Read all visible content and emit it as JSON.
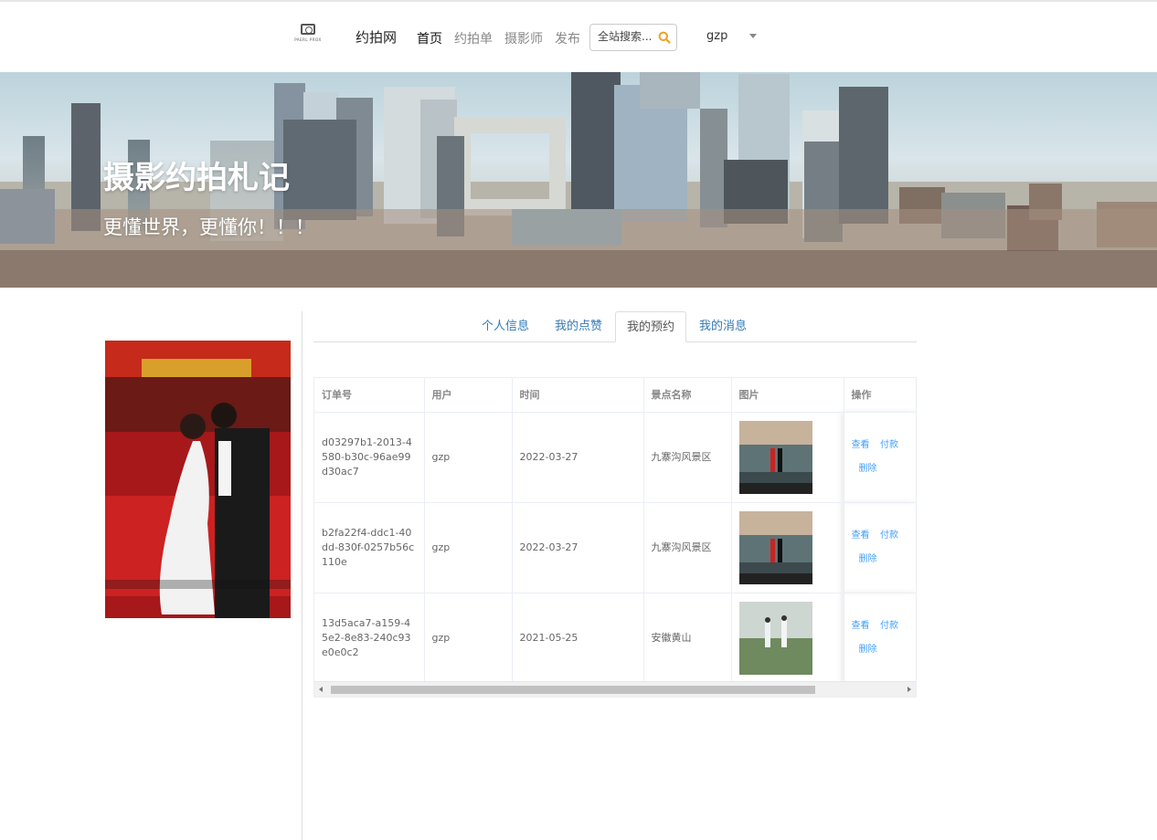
{
  "header": {
    "logo_text": "PAERL PROX",
    "brand": "约拍网",
    "nav": [
      "首页",
      "约拍单",
      "摄影师",
      "发布"
    ],
    "active_nav": "首页",
    "search_placeholder": "全站搜索...",
    "username": "gzp"
  },
  "banner": {
    "title": "摄影约拍札记",
    "subtitle": "更懂世界，更懂你！！！"
  },
  "tabs": [
    "个人信息",
    "我的点赞",
    "我的预约",
    "我的消息"
  ],
  "active_tab": "我的预约",
  "table": {
    "columns": [
      "订单号",
      "用户",
      "时间",
      "景点名称",
      "图片",
      "操作"
    ],
    "rows": [
      {
        "order_id": "d03297b1-2013-4580-b30c-96ae99d30ac7",
        "user": "gzp",
        "time": "2022-03-27",
        "spot": "九寨沟风景区"
      },
      {
        "order_id": "b2fa22f4-ddc1-40dd-830f-0257b56c110e",
        "user": "gzp",
        "time": "2022-03-27",
        "spot": "九寨沟风景区"
      },
      {
        "order_id": "13d5aca7-a159-45e2-8e83-240c93e0e0c2",
        "user": "gzp",
        "time": "2021-05-25",
        "spot": "安徽黄山"
      }
    ],
    "actions": {
      "view": "查看",
      "pay": "付款",
      "delete": "删除"
    }
  },
  "colors": {
    "link": "#337ab7",
    "action": "#409eff",
    "search_icon": "#f0a020"
  }
}
